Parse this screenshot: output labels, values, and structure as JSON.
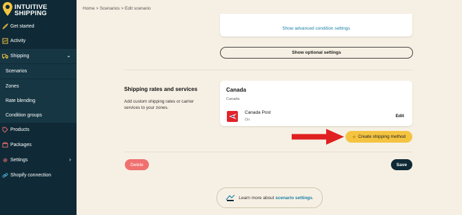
{
  "app": {
    "logo_line1": "INTUITIVE",
    "logo_line2": "SHIPPING",
    "logo_icon": "pin-icon",
    "accent": "#f4c441"
  },
  "sidebar": {
    "items": [
      {
        "label": "Get started",
        "icon": "rocket-icon"
      },
      {
        "label": "Activity",
        "icon": "activity-icon"
      },
      {
        "label": "Shipping",
        "icon": "truck-icon"
      },
      {
        "label": "Scenarios"
      },
      {
        "label": "Zones"
      },
      {
        "label": "Rate blending"
      },
      {
        "label": "Condition groups"
      },
      {
        "label": "Products",
        "icon": "tag-icon"
      },
      {
        "label": "Packages",
        "icon": "package-icon"
      },
      {
        "label": "Settings",
        "icon": "gear-icon"
      },
      {
        "label": "Shopify connection",
        "icon": "link-icon"
      }
    ]
  },
  "breadcrumb": "Home > Scenarios > Edit scenario",
  "conditions": {
    "advanced_link": "Show advanced condition settings",
    "optional_button": "Show optional settings"
  },
  "rates": {
    "title": "Shipping rates and services",
    "description": "Add custom shipping rates or carrier services to your zones.",
    "zone_name": "Canada",
    "zone_sub": "Canada",
    "carrier_name": "Canada Post",
    "carrier_status": "On",
    "edit_label": "Edit",
    "create_button": "Create shipping method",
    "create_icon": "sparkle-icon"
  },
  "actions": {
    "delete_label": "Delete",
    "save_label": "Save"
  },
  "learn": {
    "prefix": "Learn more about",
    "link": "scenario settings",
    "suffix": "."
  },
  "colors": {
    "sidebar_bg": "#0f2a36",
    "page_bg": "#f6f0e4",
    "delete": "#f07070",
    "arrow": "#e02020"
  }
}
